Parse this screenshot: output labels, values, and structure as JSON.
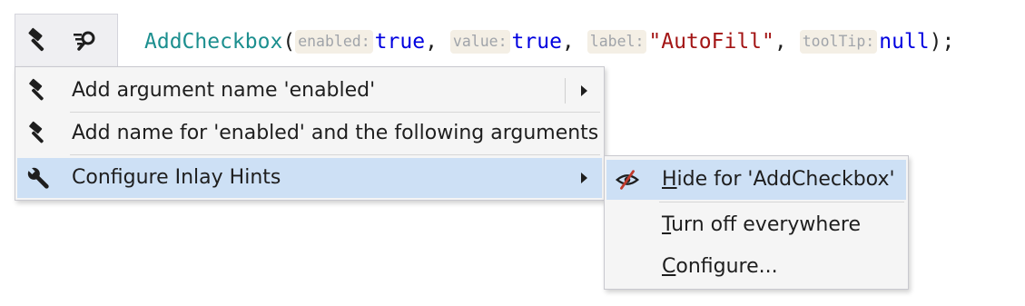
{
  "toolbar": {
    "buttons": [
      {
        "icon": "hammer-icon"
      },
      {
        "icon": "inlay-hint-search-icon"
      }
    ]
  },
  "code": {
    "method": "AddCheckbox",
    "open_paren": "(",
    "args": [
      {
        "hint": "enabled:",
        "value": "true",
        "sep": ","
      },
      {
        "hint": "value:",
        "value": "true",
        "sep": ","
      },
      {
        "hint": "label:",
        "value": "\"AutoFill\"",
        "sep": ","
      },
      {
        "hint": "toolTip:",
        "value": "null",
        "sep": ");"
      }
    ],
    "colors": {
      "method": "#1c8f8f",
      "keyword": "#0000e0",
      "string": "#a31515",
      "hint_text": "#a0a4aa",
      "hint_bg": "#f4efe5"
    }
  },
  "menu": {
    "items": [
      {
        "icon": "hammer-icon",
        "label": "Add argument name 'enabled'",
        "has_submenu": true
      },
      {
        "icon": "hammer-icon",
        "label": "Add name for 'enabled' and the following arguments",
        "has_submenu": false
      },
      {
        "icon": "wrench-icon",
        "label": "Configure Inlay Hints",
        "has_submenu": true,
        "selected": true
      }
    ],
    "selection_color": "#cde0f5"
  },
  "submenu": {
    "items": [
      {
        "icon": "hidden-eye-icon",
        "mnemonic": "H",
        "rest": "ide for 'AddCheckbox'",
        "selected": true
      },
      {
        "icon": "",
        "mnemonic": "T",
        "rest": "urn off everywhere"
      },
      {
        "icon": "",
        "mnemonic": "C",
        "rest": "onfigure..."
      }
    ]
  }
}
